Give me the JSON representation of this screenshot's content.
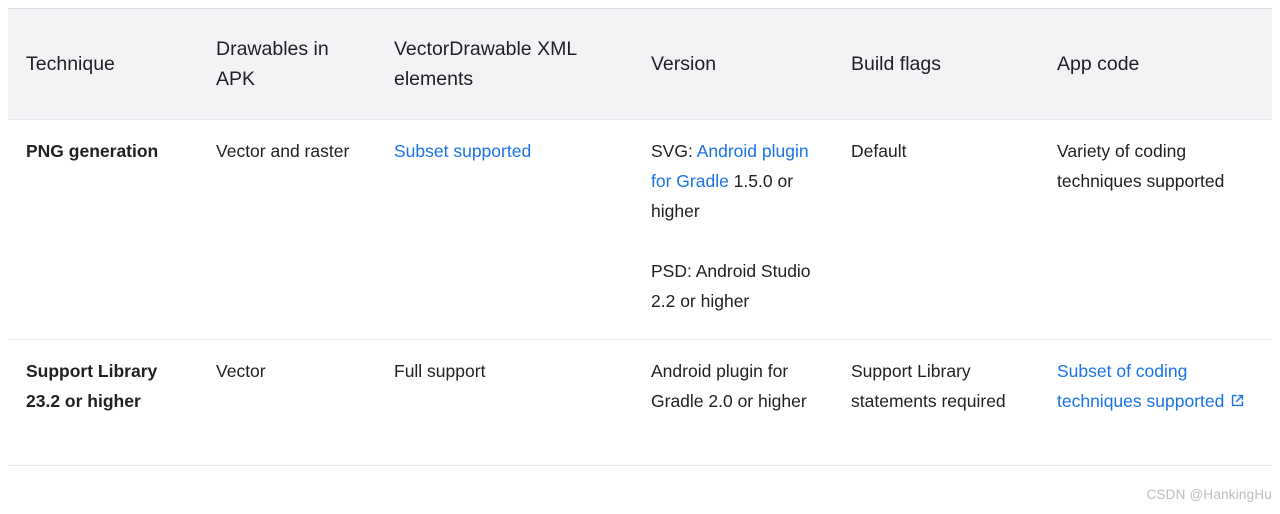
{
  "table": {
    "columns": [
      {
        "label": "Technique"
      },
      {
        "label": "Drawables in APK"
      },
      {
        "label": "VectorDrawable XML elements"
      },
      {
        "label": "Version"
      },
      {
        "label": "Build flags"
      },
      {
        "label": "App code"
      }
    ],
    "rows": [
      {
        "technique": "PNG generation",
        "drawables_in_apk": "Vector and raster",
        "xml_elements_link": "Subset supported",
        "version_p1_prefix": "SVG: ",
        "version_p1_link": "Android plugin for Gradle",
        "version_p1_suffix": " 1.5.0 or higher",
        "version_p2": "PSD: Android Studio 2.2 or higher",
        "build_flags": "Default",
        "app_code": "Variety of coding techniques supported"
      },
      {
        "technique": "Support Library 23.2 or higher",
        "drawables_in_apk": "Vector",
        "xml_elements": "Full support",
        "version": "Android plugin for Gradle 2.0 or higher",
        "build_flags": "Support Library statements required",
        "app_code_link": "Subset of coding techniques supported"
      }
    ]
  },
  "icons": {
    "external_link": "external-link-icon"
  },
  "watermark": {
    "text": "CSDN @HankingHu"
  },
  "colors": {
    "link": "#1a73e8",
    "header_background": "#f1f3f4",
    "border": "#e8eaed",
    "text": "#202124",
    "watermark": "#bdbdbd"
  }
}
